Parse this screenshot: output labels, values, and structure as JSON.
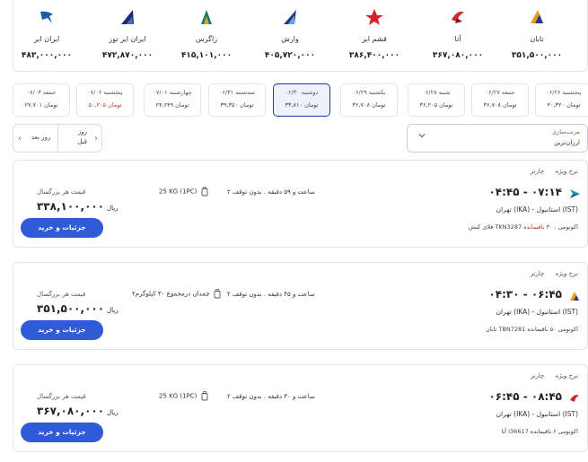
{
  "airlines": [
    {
      "name": "تابان",
      "price": "۳۵۱,۵۰۰,۰۰۰",
      "color": "#e79c1b"
    },
    {
      "name": "آتا",
      "price": "۳۶۷,۰۸۰,۰۰۰",
      "color": "#d1232a"
    },
    {
      "name": "قشم ایر",
      "price": "۳۸۶,۴۰۰,۰۰۰",
      "color": "#d1232a"
    },
    {
      "name": "وارش",
      "price": "۴۰۵,۷۲۰,۰۰۰",
      "color": "#1f3b8f"
    },
    {
      "name": "زاگرس",
      "price": "۴۱۵,۱۰۱,۰۰۰",
      "color": "#1a7a6a"
    },
    {
      "name": "ایران ایر تور",
      "price": "۴۷۲,۸۷۰,۰۰۰",
      "color": "#1c2e6e"
    },
    {
      "name": "ایران ایر",
      "price": "۴۸۳,۰۰۰,۰۰۰",
      "color": "#1a5cab"
    }
  ],
  "dates": [
    {
      "day": "پنجشنبه ۰۶/۲۶",
      "price": "۴۰,۳۲۰ تومان",
      "red": false
    },
    {
      "day": "جمعه ۰۶/۲۷",
      "price": "۳۶,۷۰۸ تومان",
      "red": false
    },
    {
      "day": "شنبه ۰۶/۲۸",
      "price": "۳۶,۲۰۵ تومان",
      "red": false
    },
    {
      "day": "یکشنبه ۰۶/۲۹",
      "price": "۳۶,۷۰۸ تومان",
      "red": false
    },
    {
      "day": "دوشنبه ۰۶/۳۰",
      "price": "۳۳,۸۱۰ تومان",
      "red": false
    },
    {
      "day": "سه‌شنبه ۰۶/۳۱",
      "price": "۳۹,۳۵۰ تومان",
      "red": false
    },
    {
      "day": "چهارشنبه ۰۷/۰۱",
      "price": "۲۴,۶۴۹ تومان",
      "red": false
    },
    {
      "day": "پنجشنبه ۰۷/۰۲",
      "price": "۵۰,۲۰۵ تومان",
      "red": true
    },
    {
      "day": "جمعه ۰۷/۰۳",
      "price": "۲۷,۷۰۱ تومان",
      "red": false
    }
  ],
  "nav": {
    "prev_label_1": "روز",
    "prev_label_2": "قبل",
    "next_label": "روز بعد"
  },
  "sort": {
    "label": "مرتب‌سازی",
    "value": "ارزان‌ترین"
  },
  "flights": [
    {
      "charter": "چارتر",
      "fare": "نرخ ویژه",
      "times": "۰۴:۴۵ - ۰۷:۱۴",
      "route": "تهران (IKA) - استانبول (IST)",
      "info": "فلای کیش TKN3287 اکونومی .",
      "seats": "۳۰ باقیمانده",
      "duration": "۲ ساعت و ۵۹ دقیقه . بدون توقف",
      "baggage": "25 KG (1PC)",
      "price_label": "قیمت هر بزرگسال",
      "price": "۳۳۸,۱۰۰,۰۰۰",
      "currency": "ریال",
      "button": "جزئیات و خرید",
      "logo_color": "#2a9bb8"
    },
    {
      "charter": "چارتر",
      "fare": "نرخ ویژه",
      "times": "۰۴:۳۰ - ۰۶:۴۵",
      "route": "تهران (IKA) - استانبول (IST)",
      "info": "تابان TBN7281 اکونومی ۵۰ باقیمانده",
      "seats": "",
      "duration": "۲ ساعت و ۴۵ دقیقه . بدون توقف",
      "baggage": "۲چمدان درمجموع ۳۰ کیلوگرم",
      "price_label": "قیمت هر بزرگسال",
      "price": "۳۵۱,۵۰۰,۰۰۰",
      "currency": "ریال",
      "button": "جزئیات و خرید",
      "logo_color": "#e79c1b"
    },
    {
      "charter": "چارتر",
      "fare": "نرخ ویژه",
      "times": "۰۶:۴۵ - ۰۸:۴۵",
      "route": "تهران (IKA) - استانبول (IST)",
      "info": "آتا I36617 اکونومی ۶ باقیمانده",
      "seats": "",
      "duration": "۲ ساعت و ۳۰ دقیقه . بدون توقف",
      "baggage": "25 KG (1PC)",
      "price_label": "قیمت هر بزرگسال",
      "price": "۳۶۷,۰۸۰,۰۰۰",
      "currency": "ریال",
      "button": "جزئیات و خرید",
      "logo_color": "#d1232a"
    }
  ]
}
